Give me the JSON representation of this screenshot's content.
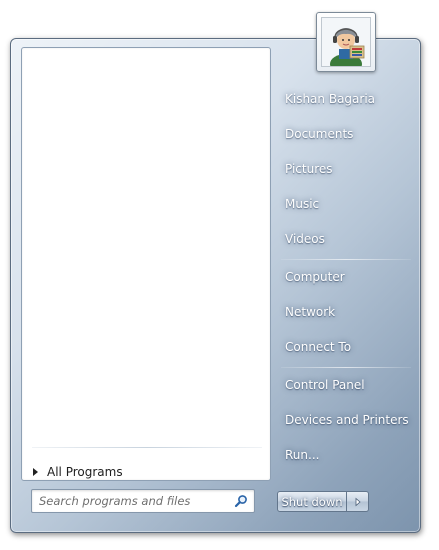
{
  "left_pane": {
    "all_programs_label": "All Programs",
    "search_placeholder": "Search programs and files"
  },
  "right_pane": {
    "items": [
      "Kishan Bagaria",
      "Documents",
      "Pictures",
      "Music",
      "Videos",
      "Computer",
      "Network",
      "Connect To",
      "Control Panel",
      "Devices and Printers",
      "Run..."
    ]
  },
  "shutdown": {
    "label": "Shut down"
  },
  "icons": {
    "search": "search-icon",
    "shutdown_arrow": "chevron-right-icon",
    "all_programs_arrow": "triangle-right-icon",
    "avatar": "user-avatar"
  }
}
